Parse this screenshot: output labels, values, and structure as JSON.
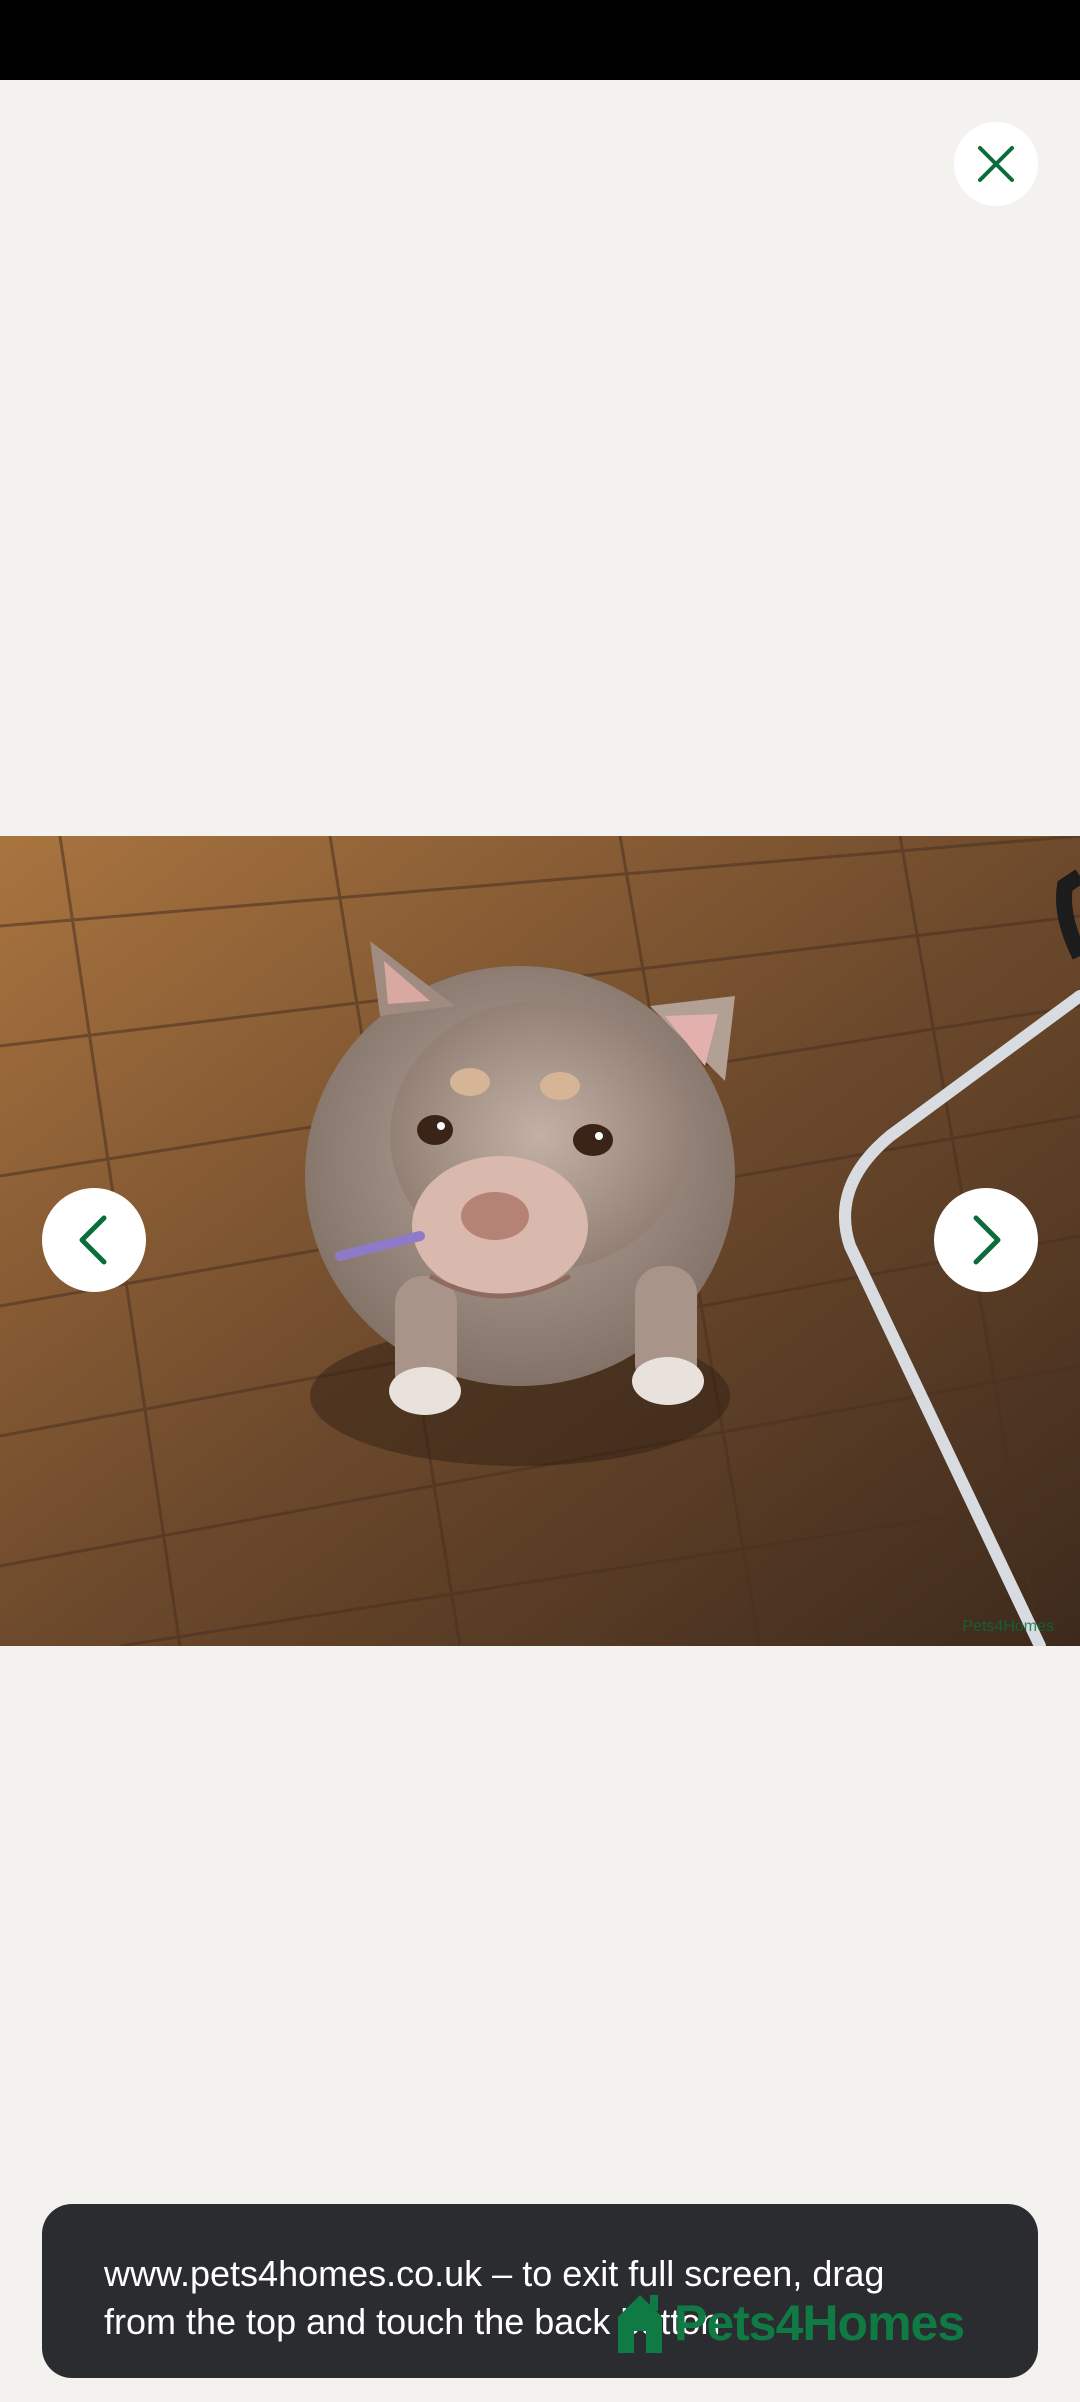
{
  "colors": {
    "background": "#f4f2ef",
    "accent": "#0b6b3a",
    "toast_background": "#2b2c30"
  },
  "viewer": {
    "close_icon": "close-icon",
    "prev_icon": "chevron-left-icon",
    "next_icon": "chevron-right-icon",
    "image_subject": "dog-photo"
  },
  "toast": {
    "line1": "www.pets4homes.co.uk – to exit full screen, drag",
    "line2": "from the top and touch the back button"
  },
  "brand": {
    "name": "Pets4Homes",
    "small_watermark": "Pets4Homes"
  }
}
